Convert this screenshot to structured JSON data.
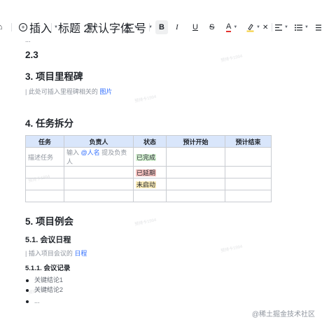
{
  "toolbar": {
    "insert_label": "插入",
    "heading_label": "标题 2",
    "font_label": "默认字体",
    "size_label": "三号",
    "bold_label": "B",
    "italic_label": "I",
    "underline_label": "U",
    "strike_label": "S",
    "font_color_label": "A",
    "font_color": "#e4332f",
    "highlight_color": "#f5d24a"
  },
  "doc": {
    "ellipsis_top": "...",
    "section_2_3": "2.3",
    "section_3": "3. 项目里程碑",
    "milestone_hint": "| 此处可插入里程碑相关的",
    "milestone_link": "图片",
    "section_4": "4. 任务拆分",
    "table": {
      "headers": [
        "任务",
        "负责人",
        "状态",
        "预计开始",
        "预计结束"
      ],
      "row1": {
        "task": "描述任务",
        "owner_prefix": "输入",
        "owner_mention": "@人名",
        "owner_suffix": "提及负责人",
        "status": "已完成"
      },
      "row2_status": "已延期",
      "row3_status": "未启动",
      "status_colors": {
        "done": "#d9f5d6",
        "delayed": "#f8c3c0",
        "notstarted": "#fcedb9"
      }
    },
    "section_5": "5. 项目例会",
    "section_5_1": "5.1. 会议日程",
    "meeting_hint": "| 插入项目会议的",
    "meeting_link": "日程",
    "section_5_1_1": "5.1.1. 会议记录",
    "bullets": [
      "关键结论1",
      "关键结论2",
      "..."
    ]
  },
  "watermark_text": "预排卡1994",
  "footer_watermark": "@稀土掘金技术社区"
}
